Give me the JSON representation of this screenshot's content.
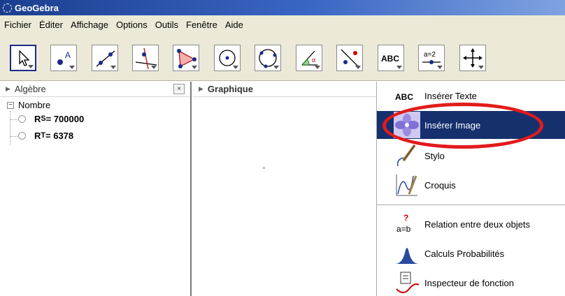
{
  "window": {
    "title": "GeoGebra"
  },
  "menu": [
    "Fichier",
    "Éditer",
    "Affichage",
    "Options",
    "Outils",
    "Fenêtre",
    "Aide"
  ],
  "toolbar": {
    "tools": [
      {
        "name": "move-tool"
      },
      {
        "name": "point-tool"
      },
      {
        "name": "line-tool"
      },
      {
        "name": "perpendicular-tool"
      },
      {
        "name": "polygon-tool"
      },
      {
        "name": "circle-center-tool"
      },
      {
        "name": "circle-three-points-tool"
      },
      {
        "name": "angle-tool"
      },
      {
        "name": "reflect-tool"
      },
      {
        "name": "text-tool",
        "label": "ABC"
      },
      {
        "name": "slider-tool",
        "label": "a=2"
      },
      {
        "name": "move-graphics-tool"
      }
    ]
  },
  "algebra": {
    "title": "Algèbre",
    "close": "×",
    "category": "Nombre",
    "items": [
      {
        "var": "R",
        "sub": "S",
        "value": " = 700000"
      },
      {
        "var": "R",
        "sub": "T",
        "value": " = 6378"
      }
    ]
  },
  "graphics": {
    "title": "Graphique"
  },
  "dropdown": {
    "items": [
      {
        "icon": "abc-text-icon",
        "icon_label": "ABC",
        "label": "Insérer Texte",
        "selected": false
      },
      {
        "icon": "flower-image-icon",
        "label": "Insérer Image",
        "selected": true
      },
      {
        "icon": "pen-icon",
        "label": "Stylo",
        "selected": false
      },
      {
        "icon": "sketch-function-icon",
        "label": "Croquis",
        "selected": false
      },
      {
        "icon": "relation-icon",
        "icon_label": "a=b",
        "label": "Relation entre deux objets",
        "selected": false
      },
      {
        "icon": "bell-curve-icon",
        "label": "Calculs Probabilités",
        "selected": false
      },
      {
        "icon": "function-inspector-icon",
        "label": "Inspecteur de fonction",
        "selected": false
      }
    ]
  },
  "colors": {
    "selected_item": "#16306e",
    "annotation_circle": "#e21b1b",
    "title_bar": "#1b3f8f"
  }
}
